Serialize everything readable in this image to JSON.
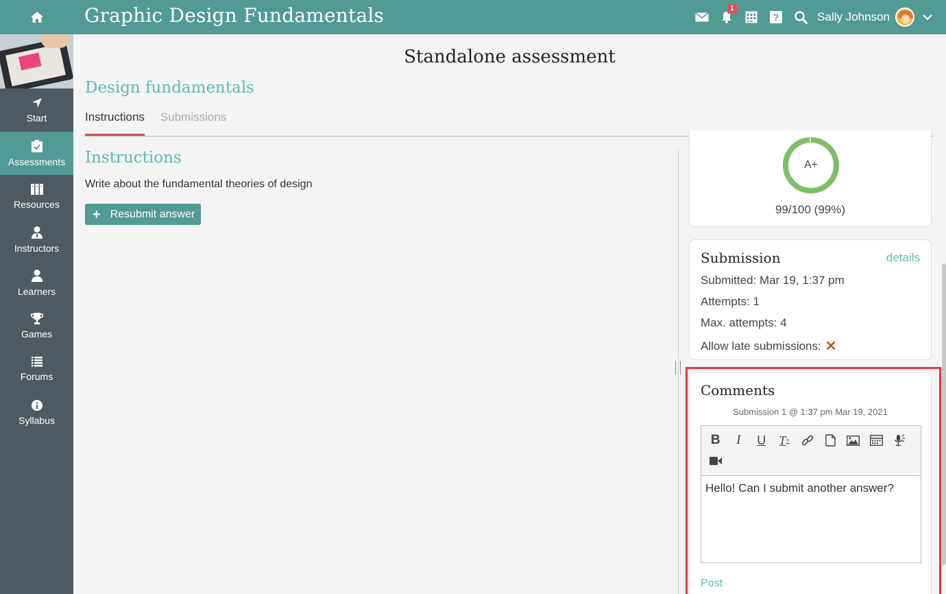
{
  "header": {
    "course_title": "Graphic Design Fundamentals",
    "notification_count": "1",
    "user_name": "Sally Johnson",
    "icons": [
      "home-icon",
      "mail-icon",
      "bell-icon",
      "calendar-icon",
      "help-icon",
      "search-icon",
      "chevron-down-icon"
    ]
  },
  "sidebar": {
    "items": [
      {
        "label": "Start",
        "icon": "navigation-arrow-icon",
        "active": false
      },
      {
        "label": "Assessments",
        "icon": "clipboard-check-icon",
        "active": true
      },
      {
        "label": "Resources",
        "icon": "books-icon",
        "active": false
      },
      {
        "label": "Instructors",
        "icon": "instructor-icon",
        "active": false
      },
      {
        "label": "Learners",
        "icon": "user-icon",
        "active": false
      },
      {
        "label": "Games",
        "icon": "trophy-icon",
        "active": false
      },
      {
        "label": "Forums",
        "icon": "list-icon",
        "active": false
      },
      {
        "label": "Syllabus",
        "icon": "info-icon",
        "active": false
      }
    ]
  },
  "main": {
    "page_title": "Standalone assessment",
    "assessment_name": "Design fundamentals",
    "tabs": [
      {
        "label": "Instructions",
        "active": true
      },
      {
        "label": "Submissions",
        "active": false
      }
    ],
    "instructions_heading": "Instructions",
    "instructions_text": "Write about the fundamental theories of design",
    "resubmit_label": "Resubmit answer"
  },
  "grade": {
    "letter": "A+",
    "score": "99/100 (99%)",
    "percent": 99,
    "ring_color": "#7dbf63"
  },
  "submission": {
    "title": "Submission",
    "details_label": "details",
    "submitted": "Submitted: Mar 19, 1:37 pm",
    "attempts": "Attempts: 1",
    "max_attempts": "Max. attempts: 4",
    "allow_late": "Allow late submissions:",
    "allow_late_value": "✕"
  },
  "comments": {
    "title": "Comments",
    "meta": "Submission 1 @ 1:37 pm Mar 19, 2021",
    "editor_text": "Hello! Can I submit another answer?",
    "post_label": "Post",
    "toolbar": {
      "bold": "B",
      "italic": "I",
      "underline": "U",
      "clear_format": "T"
    }
  },
  "colors": {
    "brand": "#529b95",
    "accent": "#5bbcb4",
    "sidebar": "#4f5961",
    "highlight": "#e8383e"
  }
}
